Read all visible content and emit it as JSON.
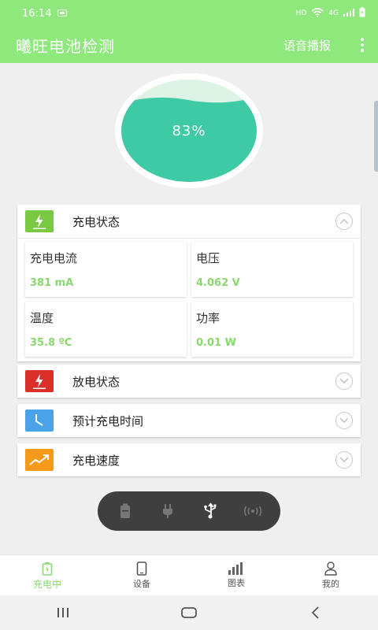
{
  "status": {
    "time": "16:14",
    "network": "HD",
    "signal_label": "4G"
  },
  "appbar": {
    "title": "曦旺电池检测",
    "voice_label": "语音播报"
  },
  "battery": {
    "percent_label": "83%",
    "level": 0.83
  },
  "cards": {
    "charging": {
      "title": "充电状态",
      "expanded": true,
      "metrics": [
        {
          "label": "充电电流",
          "value": "381 mA"
        },
        {
          "label": "电压",
          "value": "4.062 V"
        },
        {
          "label": "温度",
          "value": "35.8 ºC"
        },
        {
          "label": "功率",
          "value": "0.01 W"
        }
      ]
    },
    "discharging": {
      "title": "放电状态"
    },
    "estimate": {
      "title": "预计充电时间"
    },
    "speed": {
      "title": "充电速度"
    }
  },
  "dock": {
    "active": "usb"
  },
  "tabs": [
    {
      "label": "充电中",
      "active": true
    },
    {
      "label": "设备"
    },
    {
      "label": "图表"
    },
    {
      "label": "我的"
    }
  ],
  "colors": {
    "brand": "#8fe87c",
    "accent_text": "#8ad86f",
    "water": "#3dcaa4",
    "charging_icon": "#7ac943",
    "discharge_icon": "#d9302c",
    "estimate_icon": "#4aa3e8",
    "speed_icon": "#f59a1a",
    "dock": "#3f3f3f"
  }
}
